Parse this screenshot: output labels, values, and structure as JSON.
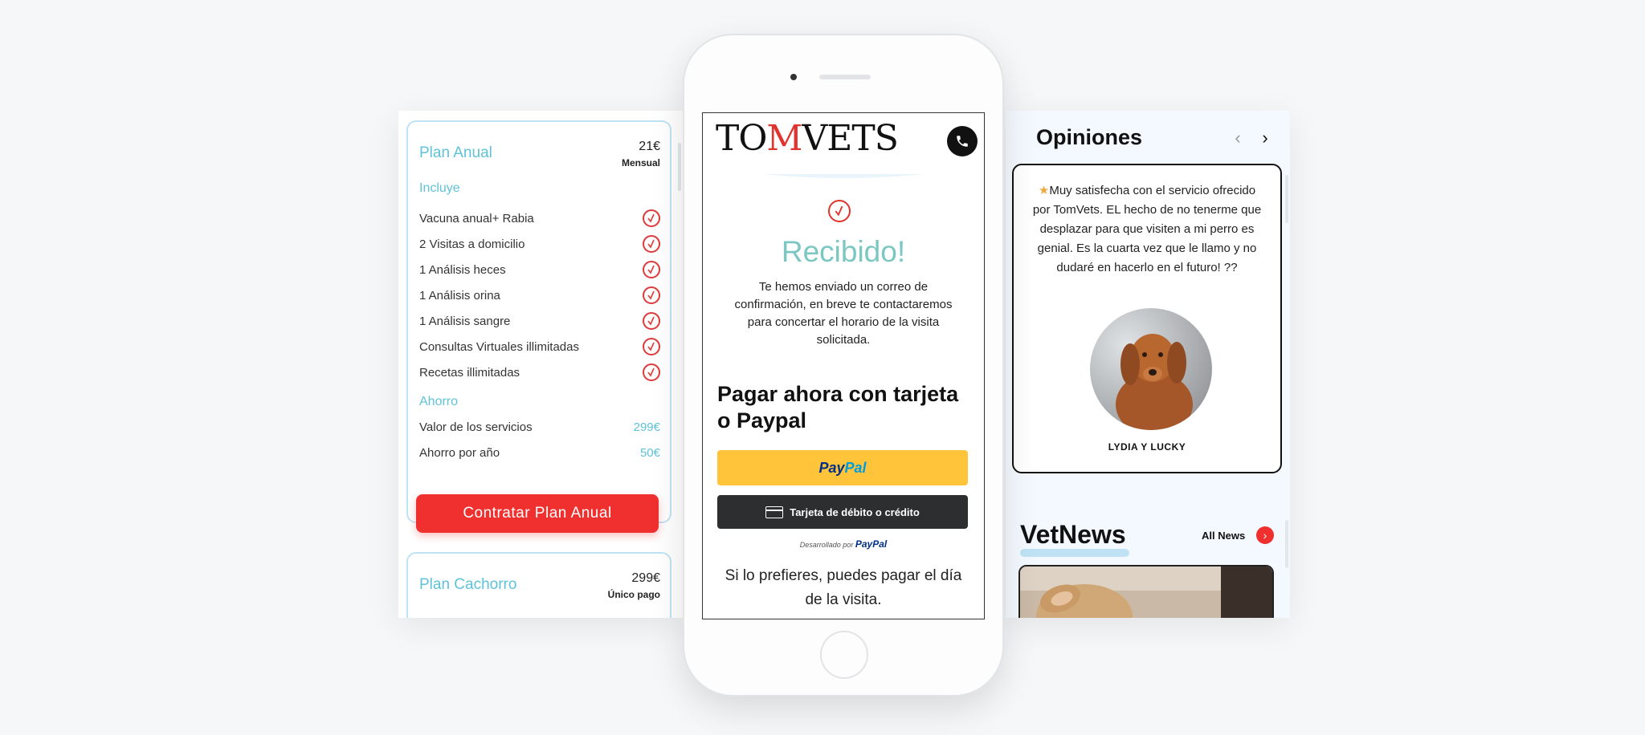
{
  "plans": {
    "anual": {
      "title": "Plan Anual",
      "price": "21€",
      "period": "Mensual",
      "includes_label": "Incluye",
      "features": [
        "Vacuna anual+ Rabia",
        "2 Visitas a domicilio",
        "1 Análisis heces",
        "1 Análisis orina",
        "1 Análisis sangre",
        "Consultas Virtuales illimitadas",
        "Recetas illimitadas"
      ],
      "savings_label": "Ahorro",
      "savings": [
        {
          "label": "Valor de los servicios",
          "value": "299€"
        },
        {
          "label": "Ahorro por año",
          "value": "50€"
        }
      ],
      "cta": "Contratar Plan Anual"
    },
    "cachorro": {
      "title": "Plan Cachorro",
      "price": "299€",
      "period": "Único pago"
    }
  },
  "phone": {
    "logo": {
      "part1": "TO",
      "part2": "M",
      "part3": "VETS"
    },
    "success": {
      "title": "Recibido!",
      "message": "Te hemos enviado un correo de confirmación, en breve te contactaremos para concertar el horario de la visita solicitada."
    },
    "payment": {
      "title": "Pagar ahora con tarjeta o Paypal",
      "paypal_pay": "Pay",
      "paypal_pal": "Pal",
      "card_button": "Tarjeta de débito o crédito",
      "powered_prefix": "Desarrollado por",
      "powered_brand": "PayPal",
      "later_text": "Si lo prefieres, puedes pagar el día de la visita."
    }
  },
  "opinions": {
    "title": "Opiniones",
    "prev": "‹",
    "next": "›",
    "review_text": "Muy satisfecha con el servicio ofrecido por TomVets. EL hecho de no tenerme que desplazar para que visiten a mi perro es genial. Es la cuarta vez que le llamo y no dudaré en hacerlo en el futuro! ??",
    "star": "★",
    "reviewer": "LYDIA Y LUCKY"
  },
  "news": {
    "title": "VetNews",
    "all_news": "All News",
    "all_news_icon": "›"
  },
  "colors": {
    "accent_red": "#f0302e",
    "accent_teal": "#5ec2d8",
    "success_teal": "#7cc7c2",
    "paypal_yellow": "#ffc439"
  }
}
